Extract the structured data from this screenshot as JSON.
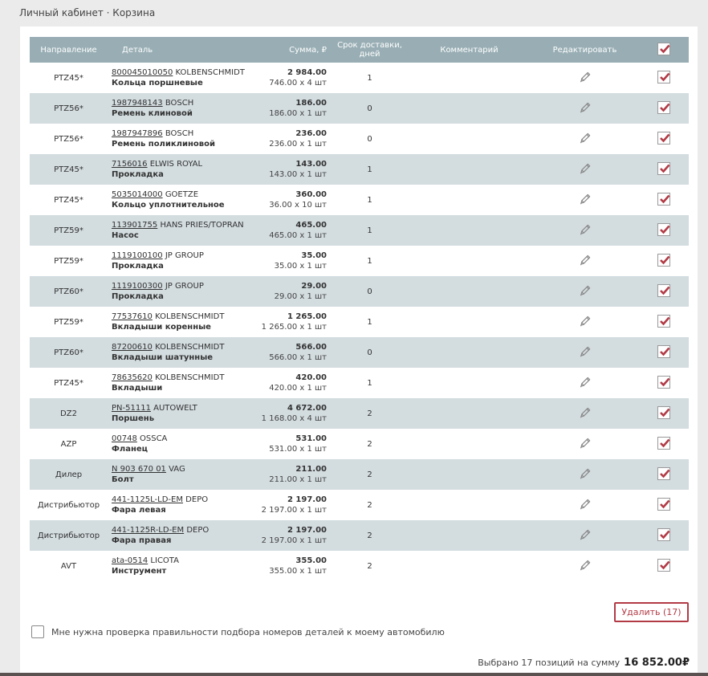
{
  "breadcrumb": "Личный кабинет · Корзина",
  "columns": {
    "direction": "Направление",
    "part": "Деталь",
    "sum": "Сумма, ₽",
    "delivery": "Срок доставки, дней",
    "comment": "Комментарий",
    "edit": "Редактировать"
  },
  "rows": [
    {
      "direction": "PTZ45*",
      "number": "800045010050",
      "brand": "KOLBENSCHMIDT",
      "name": "Кольца поршневые",
      "total": "2 984.00",
      "detail": "746.00 x 4 шт",
      "days": "1"
    },
    {
      "direction": "PTZ56*",
      "number": "1987948143",
      "brand": "BOSCH",
      "name": "Ремень клиновой",
      "total": "186.00",
      "detail": "186.00 x 1 шт",
      "days": "0"
    },
    {
      "direction": "PTZ56*",
      "number": "1987947896",
      "brand": "BOSCH",
      "name": "Ремень поликлиновой",
      "total": "236.00",
      "detail": "236.00 x 1 шт",
      "days": "0"
    },
    {
      "direction": "PTZ45*",
      "number": "7156016",
      "brand": "ELWIS ROYAL",
      "name": "Прокладка",
      "total": "143.00",
      "detail": "143.00 x 1 шт",
      "days": "1"
    },
    {
      "direction": "PTZ45*",
      "number": "5035014000",
      "brand": "GOETZE",
      "name": "Кольцо уплотнительное",
      "total": "360.00",
      "detail": "36.00 x 10 шт",
      "days": "1"
    },
    {
      "direction": "PTZ59*",
      "number": "113901755",
      "brand": "HANS PRIES/TOPRAN",
      "name": "Насос",
      "total": "465.00",
      "detail": "465.00 x 1 шт",
      "days": "1"
    },
    {
      "direction": "PTZ59*",
      "number": "1119100100",
      "brand": "JP GROUP",
      "name": "Прокладка",
      "total": "35.00",
      "detail": "35.00 x 1 шт",
      "days": "1"
    },
    {
      "direction": "PTZ60*",
      "number": "1119100300",
      "brand": "JP GROUP",
      "name": "Прокладка",
      "total": "29.00",
      "detail": "29.00 x 1 шт",
      "days": "0"
    },
    {
      "direction": "PTZ59*",
      "number": "77537610",
      "brand": "KOLBENSCHMIDT",
      "name": "Вкладыши коренные",
      "total": "1 265.00",
      "detail": "1 265.00 x 1 шт",
      "days": "1"
    },
    {
      "direction": "PTZ60*",
      "number": "87200610",
      "brand": "KOLBENSCHMIDT",
      "name": "Вкладыши шатунные",
      "total": "566.00",
      "detail": "566.00 x 1 шт",
      "days": "0"
    },
    {
      "direction": "PTZ45*",
      "number": "78635620",
      "brand": "KOLBENSCHMIDT",
      "name": "Вкладыши",
      "total": "420.00",
      "detail": "420.00 x 1 шт",
      "days": "1"
    },
    {
      "direction": "DZ2",
      "number": "PN-51111",
      "brand": "AUTOWELT",
      "name": "Поршень",
      "total": "4 672.00",
      "detail": "1 168.00 x 4 шт",
      "days": "2"
    },
    {
      "direction": "AZP",
      "number": "00748",
      "brand": "OSSCA",
      "name": "Фланец",
      "total": "531.00",
      "detail": "531.00 x 1 шт",
      "days": "2"
    },
    {
      "direction": "Дилер",
      "number": "N 903 670 01",
      "brand": "VAG",
      "name": "Болт",
      "total": "211.00",
      "detail": "211.00 x 1 шт",
      "days": "2"
    },
    {
      "direction": "Дистрибьютор",
      "number": "441-1125L-LD-EM",
      "brand": "DEPO",
      "name": "Фара левая",
      "total": "2 197.00",
      "detail": "2 197.00 x 1 шт",
      "days": "2"
    },
    {
      "direction": "Дистрибьютор",
      "number": "441-1125R-LD-EM",
      "brand": "DEPO",
      "name": "Фара правая",
      "total": "2 197.00",
      "detail": "2 197.00 x 1 шт",
      "days": "2"
    },
    {
      "direction": "AVT",
      "number": "ata-0514",
      "brand": "LICOTA",
      "name": "Инструмент",
      "total": "355.00",
      "detail": "355.00 x 1 шт",
      "days": "2"
    }
  ],
  "delete_button": "Удалить (17)",
  "verify_label": "Мне нужна проверка правильности подбора номеров деталей к моему автомобилю",
  "summary_text": "Выбрано 17 позиций на сумму",
  "summary_amount": "16 852.00₽",
  "colors": {
    "header": "#98aeb4",
    "stripe": "#d3dcdf",
    "accent": "#b23a45"
  },
  "icons": {
    "edit": "pencil-icon",
    "check": "checkmark-icon"
  }
}
